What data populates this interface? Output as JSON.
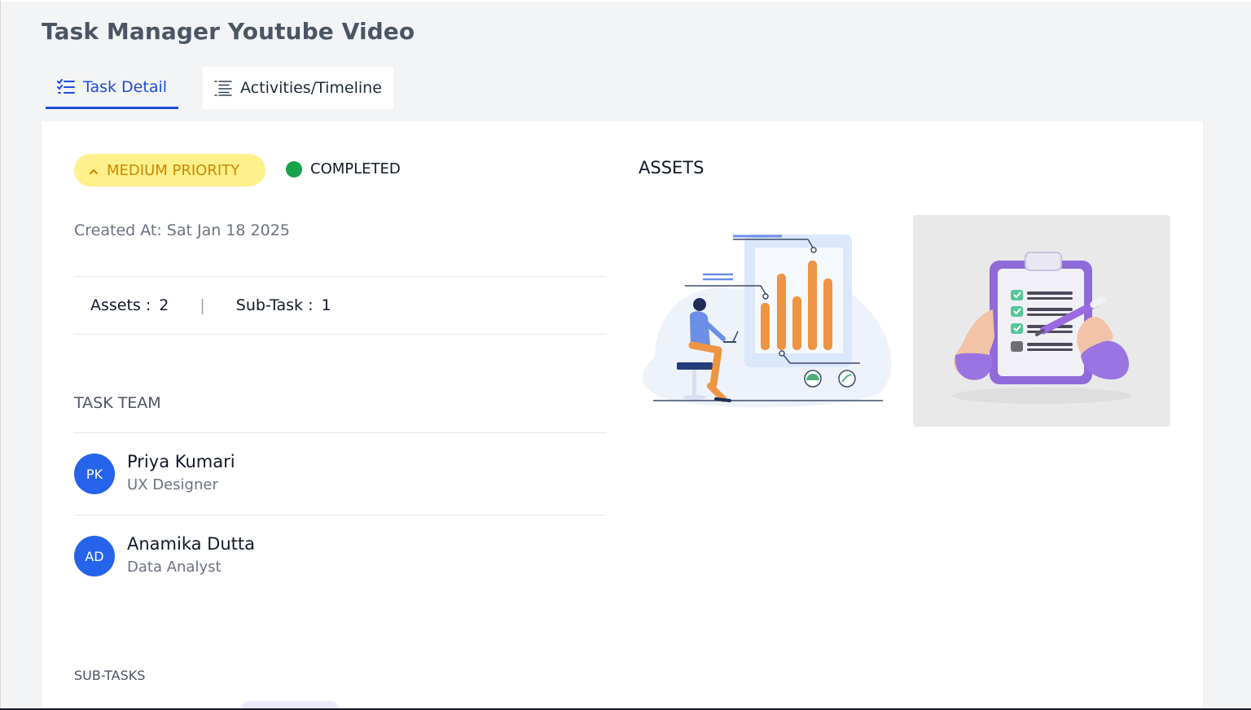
{
  "page": {
    "title": "Task Manager Youtube Video"
  },
  "tabs": [
    {
      "label": "Task Detail",
      "icon": "checklist-icon",
      "active": true
    },
    {
      "label": "Activities/Timeline",
      "icon": "list-icon",
      "active": false
    }
  ],
  "task": {
    "priority_label": "MEDIUM PRIORITY",
    "status_label": "COMPLETED",
    "created_at": "Created At: Sat Jan 18 2025",
    "assets_label": "Assets :",
    "assets_count": "2",
    "separator": "|",
    "subtask_label": "Sub-Task :",
    "subtask_count": "1"
  },
  "team": {
    "label": "TASK TEAM",
    "members": [
      {
        "initials": "PK",
        "name": "Priya Kumari",
        "role": "UX Designer"
      },
      {
        "initials": "AD",
        "name": "Anamika Dutta",
        "role": "Data Analyst"
      }
    ]
  },
  "assets": {
    "title": "ASSETS",
    "items": [
      {
        "name": "analytics-illustration"
      },
      {
        "name": "checklist-clipboard-illustration"
      }
    ]
  },
  "subtasks": {
    "label": "SUB-TASKS"
  },
  "colors": {
    "accent": "#1d4ed8",
    "avatar": "#2563eb",
    "priority_bg": "#fef08a",
    "priority_text": "#ca8a04",
    "status_completed": "#16a34a"
  }
}
